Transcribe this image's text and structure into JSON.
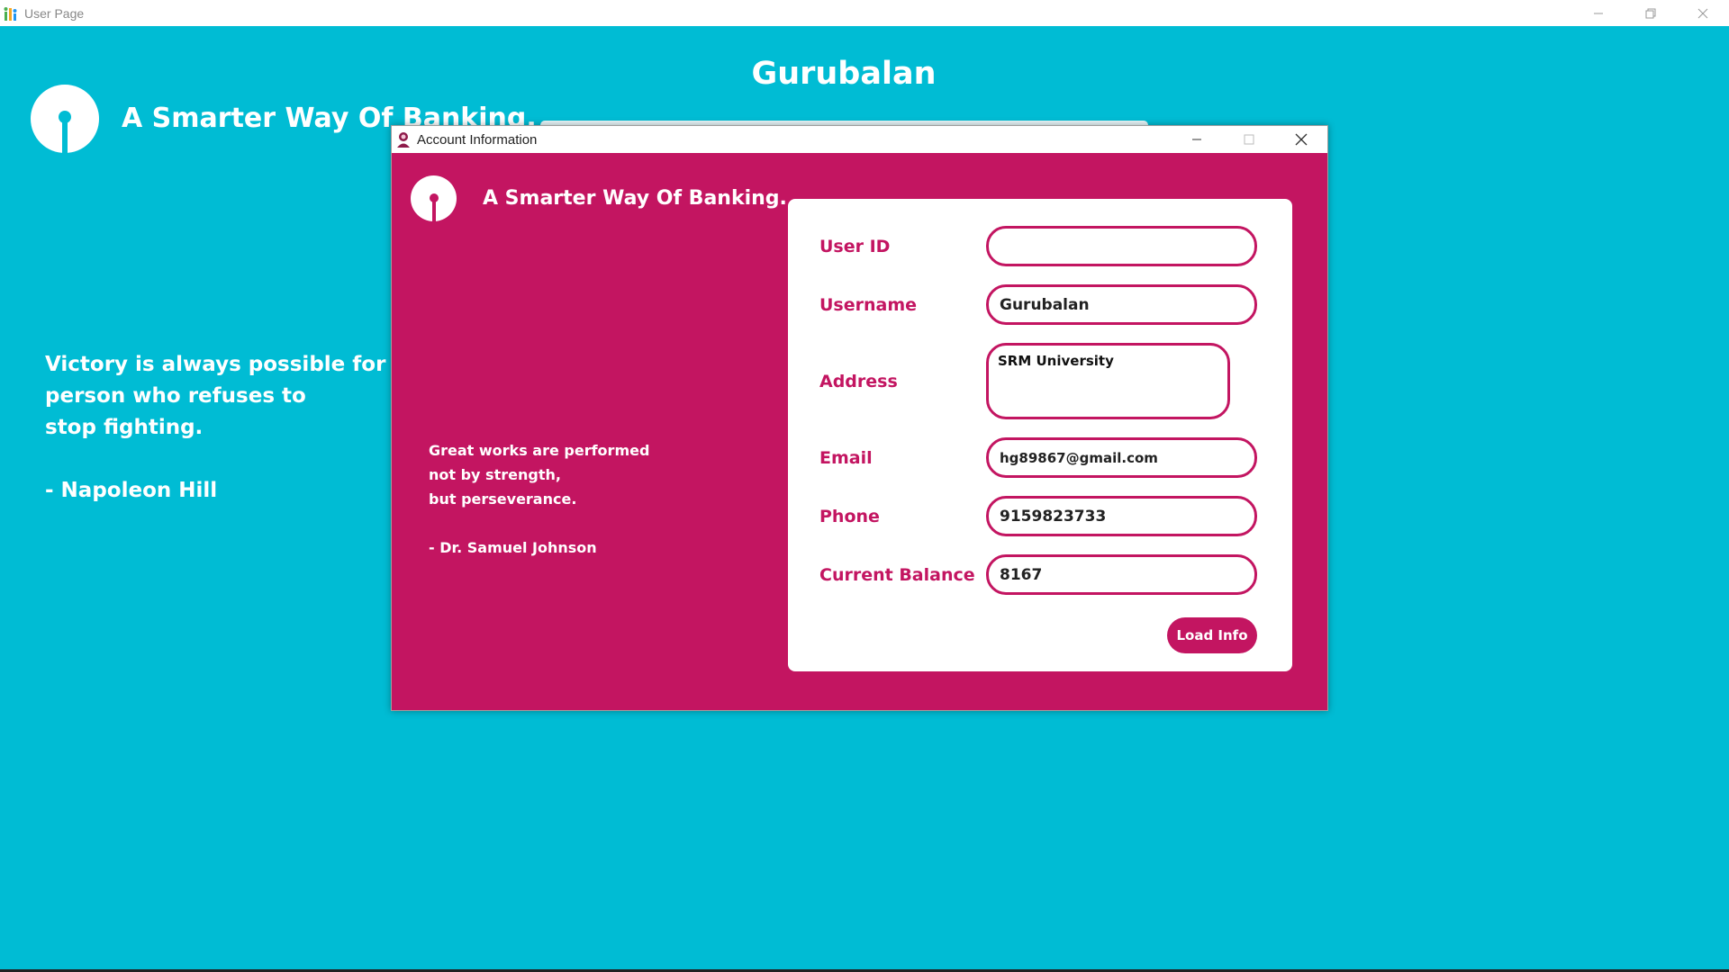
{
  "window": {
    "title": "User Page",
    "controls": {
      "minimize_icon": "minimize-icon",
      "restore_icon": "restore-icon",
      "close_icon": "close-icon"
    }
  },
  "main": {
    "heading": "Gurubalan",
    "tagline": "A Smarter Way Of Banking.",
    "quote_lines": [
      "Victory is always possible for the",
      "person who refuses to",
      "stop fighting."
    ],
    "quote_author": "- Napoleon Hill"
  },
  "dialog": {
    "title": "Account Information",
    "tagline": "A Smarter Way Of Banking.",
    "quote_lines": [
      "Great works are performed",
      "not by strength,",
      "but perseverance."
    ],
    "quote_author": "- Dr. Samuel Johnson",
    "form": {
      "user_id": {
        "label": "User ID",
        "value": ""
      },
      "username": {
        "label": "Username",
        "value": "Gurubalan"
      },
      "address": {
        "label": "Address",
        "value": "SRM University"
      },
      "email": {
        "label": "Email",
        "value": "hg89867@gmail.com"
      },
      "phone": {
        "label": "Phone",
        "value": "9159823733"
      },
      "balance": {
        "label": "Current Balance",
        "value": "8167"
      },
      "load_button": "Load Info"
    }
  },
  "colors": {
    "background": "#00bcd4",
    "accent": "#c31561",
    "text_light": "#ffffff"
  }
}
